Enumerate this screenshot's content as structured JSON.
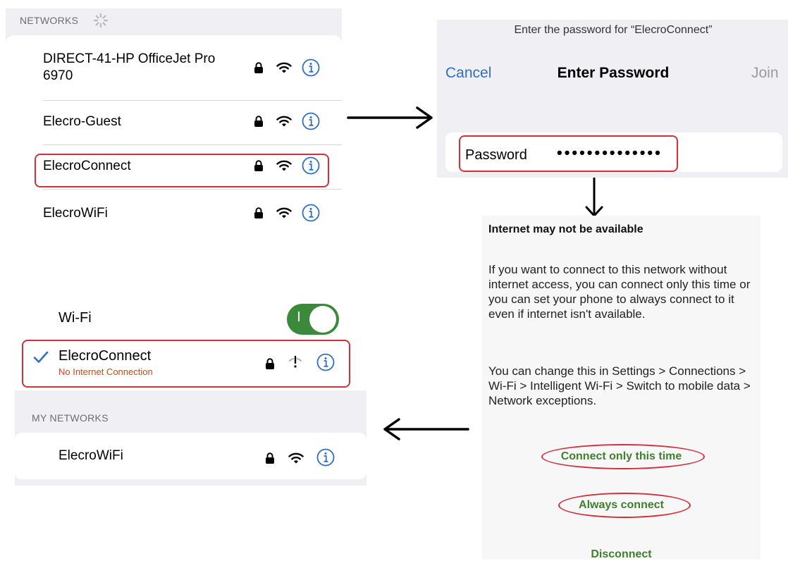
{
  "panel_networks": {
    "section_header": "NETWORKS",
    "networks": [
      {
        "name": "DIRECT-41-HP OfficeJet Pro 6970"
      },
      {
        "name": "Elecro-Guest"
      },
      {
        "name": "ElecroConnect"
      },
      {
        "name": "ElecroWiFi"
      }
    ],
    "icons": [
      "lock-icon",
      "wifi-icon",
      "info-icon",
      "spinner-icon"
    ]
  },
  "panel_password": {
    "prompt": "Enter the password for “ElecroConnect”",
    "cancel": "Cancel",
    "title": "Enter Password",
    "join": "Join",
    "password_label": "Password",
    "password_value": "••••••••••••••"
  },
  "panel_dialog": {
    "title": "Internet may not be available",
    "body": "If you want to connect to this network without internet access, you can connect only this time or you can set your phone to always connect to it even if internet isn't available.",
    "body2": "You can change this in Settings > Connections > Wi-Fi > Intelligent Wi-Fi > Switch to mobile data > Network exceptions.",
    "buttons": {
      "connect_once": "Connect only this time",
      "always": "Always connect",
      "disconnect": "Disconnect"
    }
  },
  "panel_connected": {
    "wifi_label": "Wi-Fi",
    "wifi_enabled": true,
    "connected_network": "ElecroConnect",
    "connected_status": "No Internet Connection",
    "my_networks_header": "MY NETWORKS",
    "my_networks": [
      "ElecroWiFi"
    ]
  },
  "colors": {
    "accent_blue": "#2f6fc3",
    "highlight_red": "#d32f3d",
    "button_green": "#3f7f2d",
    "toggle_green": "#3b8a3b",
    "status_orange": "#d9411f"
  }
}
